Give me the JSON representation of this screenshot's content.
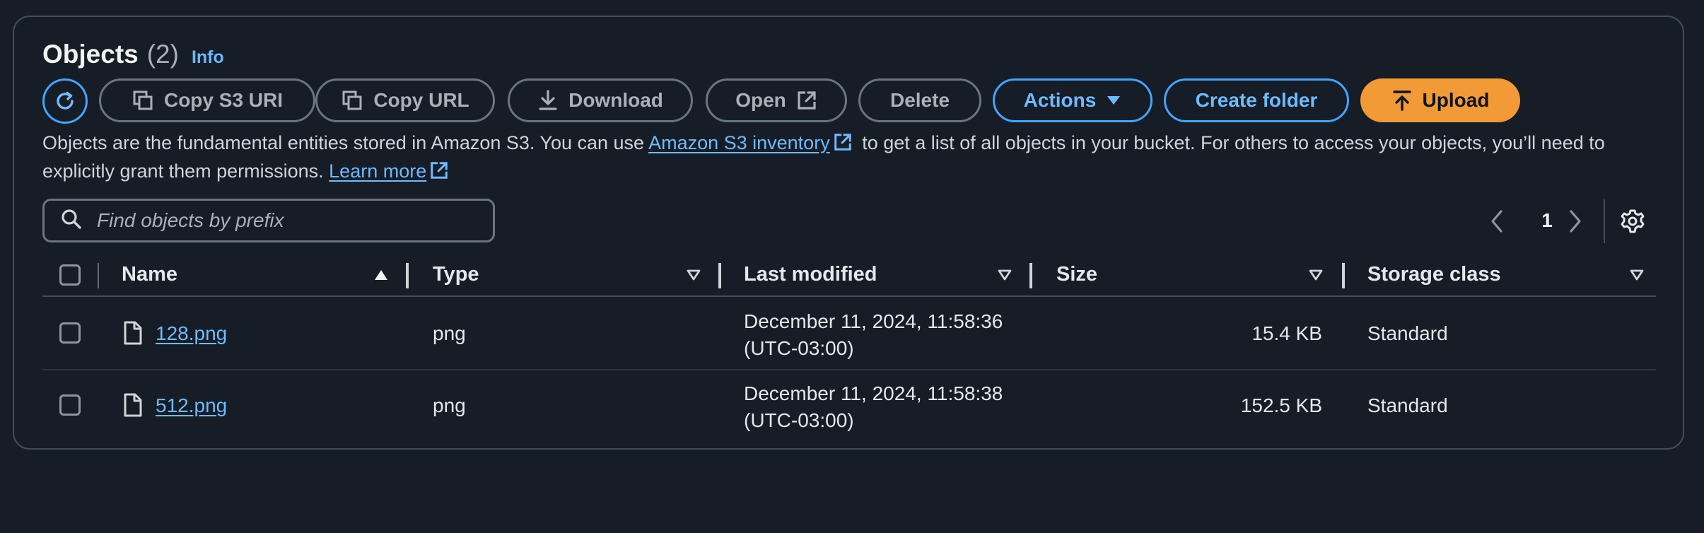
{
  "header": {
    "title": "Objects",
    "count": "(2)",
    "info_label": "Info"
  },
  "toolbar": {
    "refresh_icon": "refresh-icon",
    "copy_s3_uri_label": "Copy S3 URI",
    "copy_url_label": "Copy URL",
    "download_label": "Download",
    "open_label": "Open",
    "delete_label": "Delete",
    "actions_label": "Actions",
    "create_folder_label": "Create folder",
    "upload_label": "Upload"
  },
  "description": {
    "part1": "Objects are the fundamental entities stored in Amazon S3. You can use ",
    "inventory_link": "Amazon S3 inventory",
    "part2": " to get a list of all objects in your bucket. For others to access your objects, you’ll need to explicitly grant them permissions. ",
    "learn_more": "Learn more"
  },
  "search": {
    "placeholder": "Find objects by prefix",
    "value": ""
  },
  "pagination": {
    "current_page": "1"
  },
  "table": {
    "columns": [
      "Name",
      "Type",
      "Last modified",
      "Size",
      "Storage class"
    ],
    "rows": [
      {
        "name": "128.png",
        "type": "png",
        "last_modified_line1": "December 11, 2024, 11:58:36",
        "last_modified_line2": "(UTC-03:00)",
        "size": "15.4 KB",
        "storage_class": "Standard"
      },
      {
        "name": "512.png",
        "type": "png",
        "last_modified_line1": "December 11, 2024, 11:58:38",
        "last_modified_line2": "(UTC-03:00)",
        "size": "152.5 KB",
        "storage_class": "Standard"
      }
    ]
  },
  "colors": {
    "background": "#161d26",
    "accent_blue": "#42a5ff",
    "link_blue": "#6fbaff",
    "upload_orange": "#f19a36",
    "border_gray": "#414d5c"
  }
}
